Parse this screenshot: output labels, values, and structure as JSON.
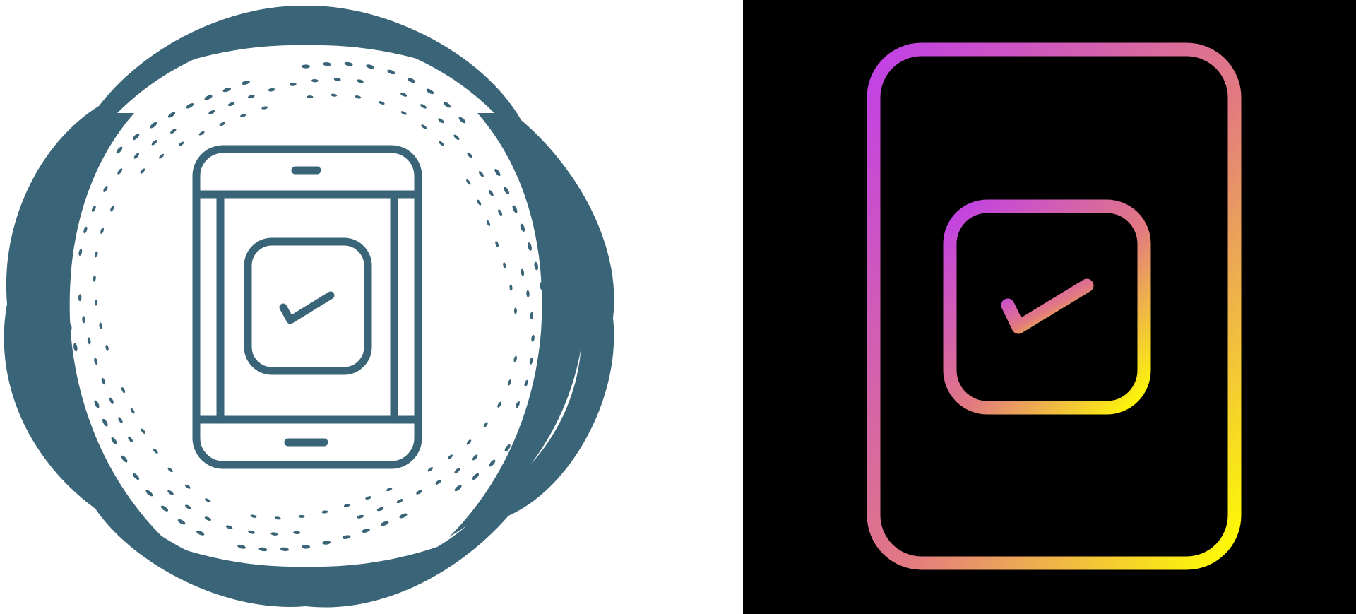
{
  "icons": {
    "left": {
      "name": "phone-checkbox-icon",
      "style": "line",
      "background": "#ffffff",
      "stroke": "#3a6478"
    },
    "right": {
      "name": "phone-checkbox-icon",
      "style": "gradient-line",
      "background": "#000000",
      "gradient_start": "#c040e8",
      "gradient_mid": "#e27a80",
      "gradient_end": "#ffff00"
    }
  }
}
